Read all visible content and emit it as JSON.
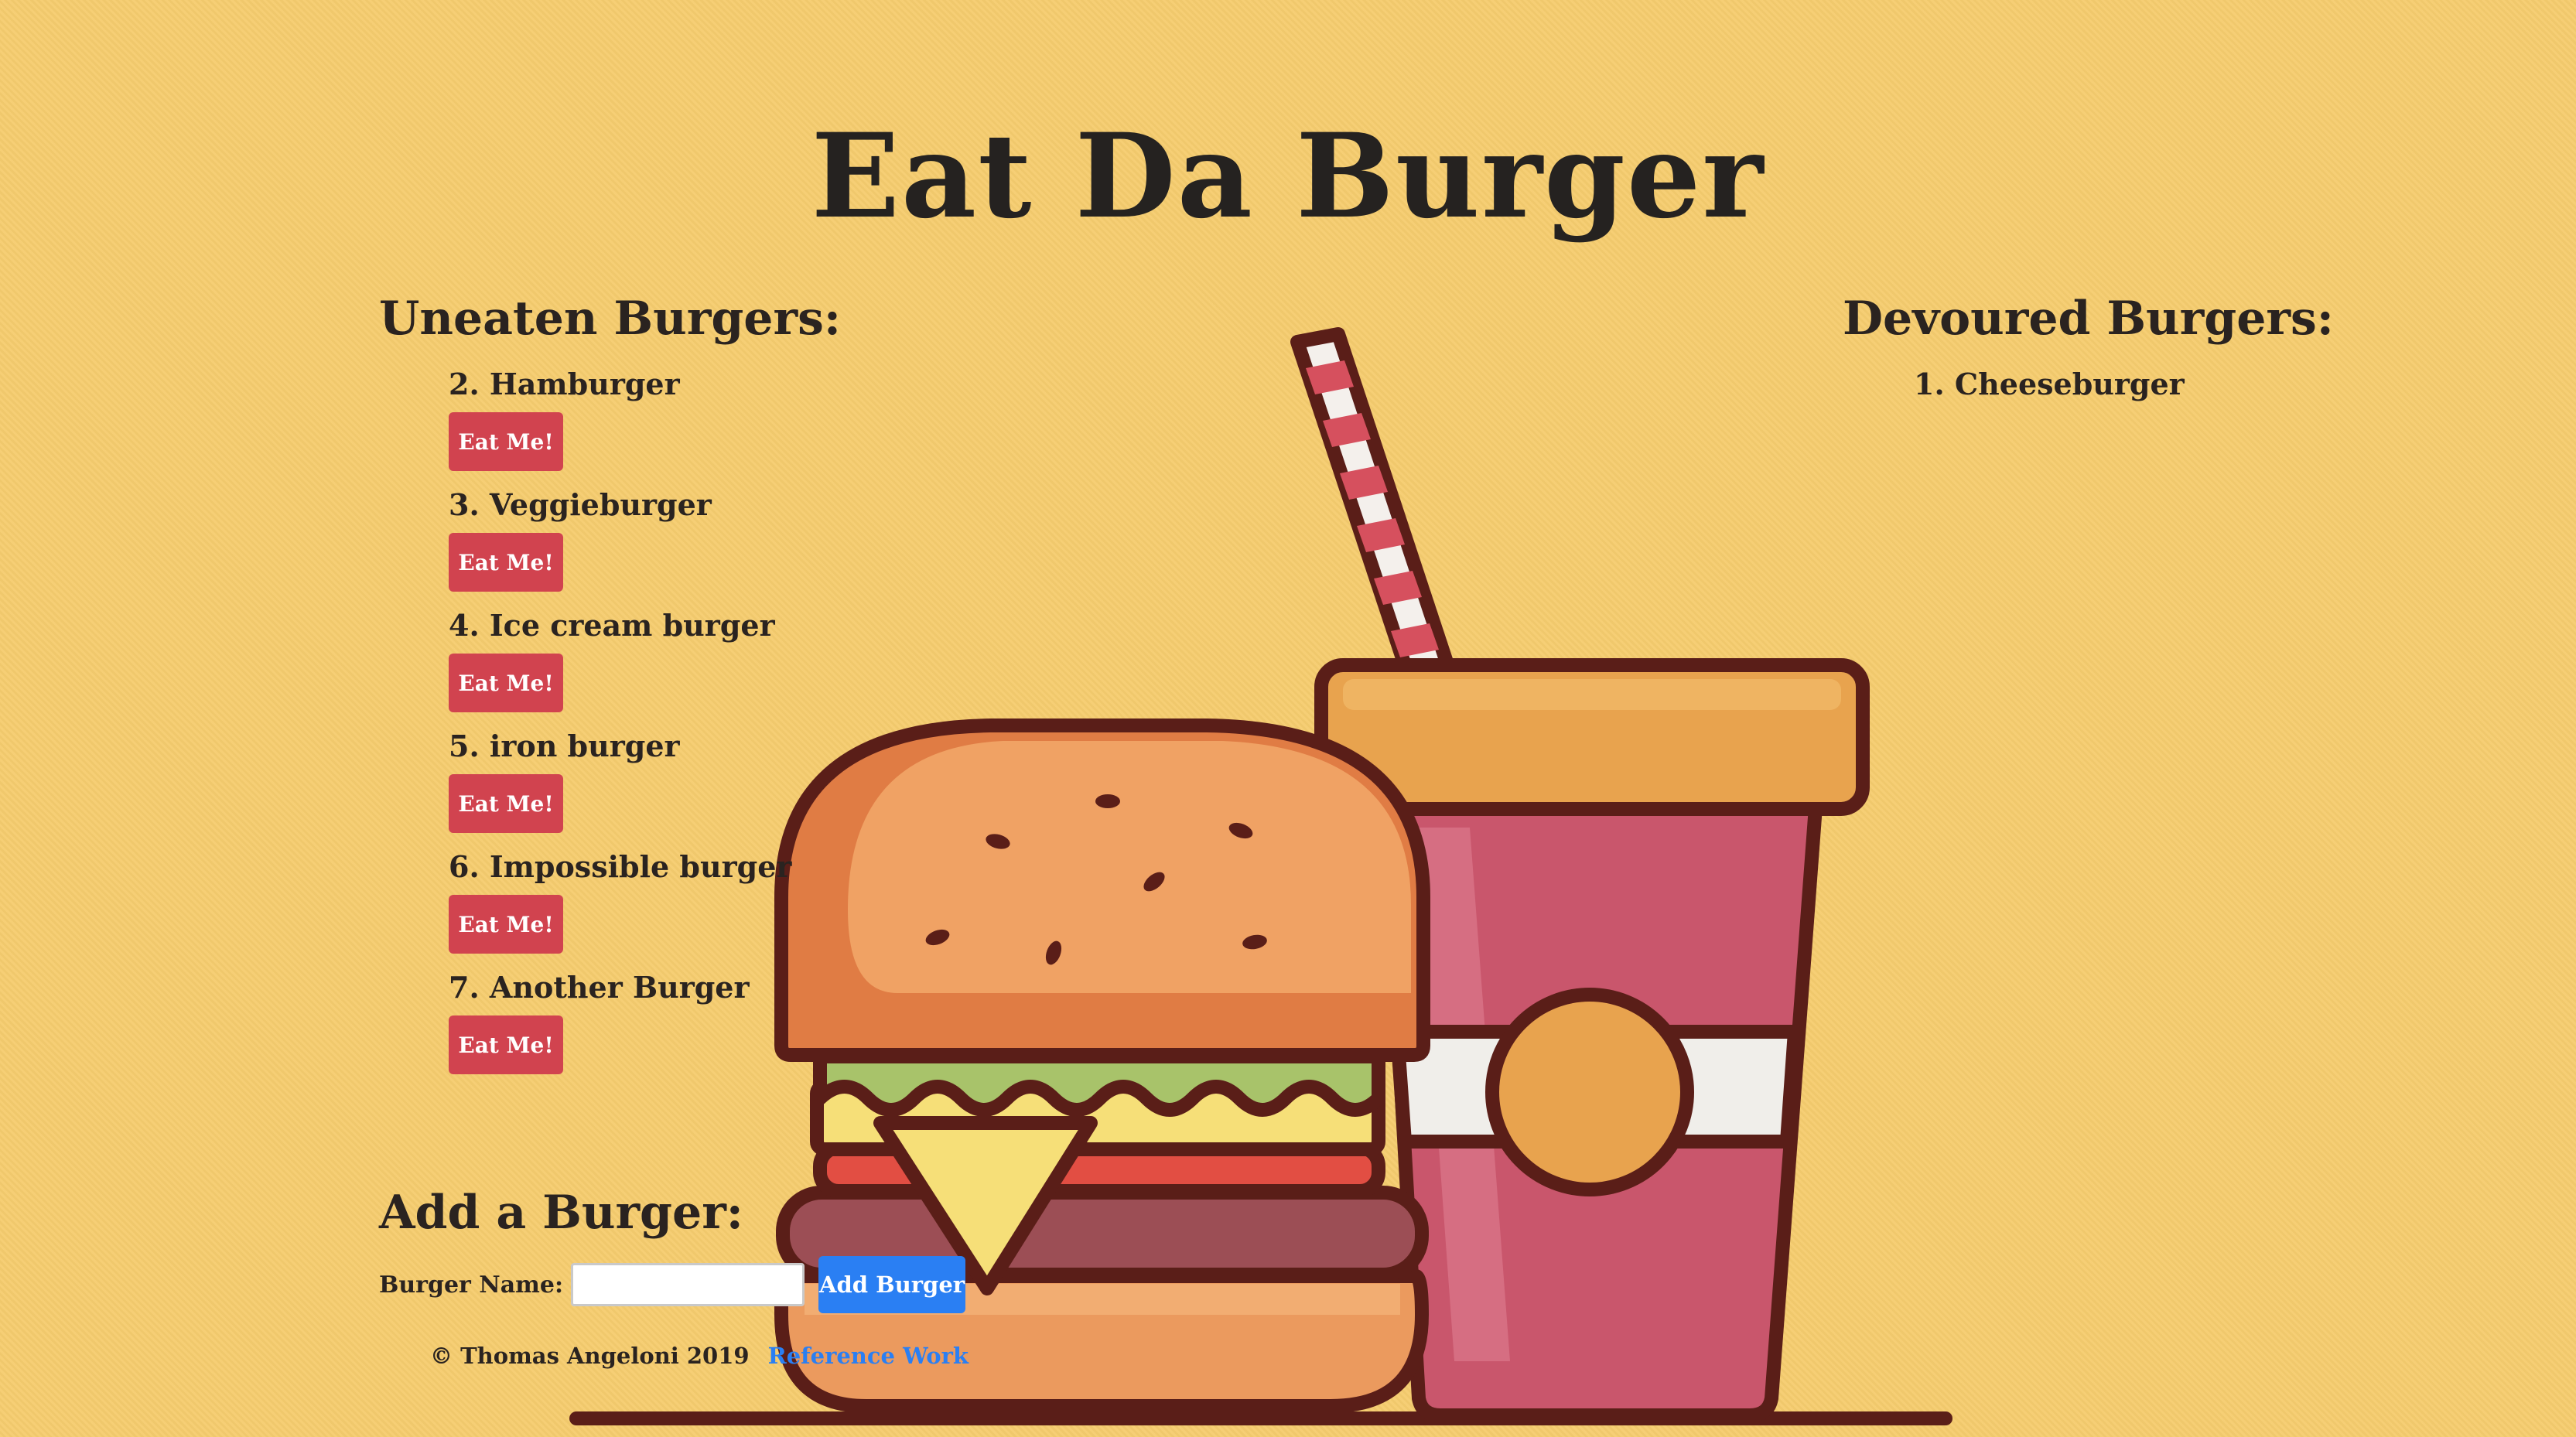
{
  "header": {
    "title": "Eat Da Burger"
  },
  "uneaten": {
    "heading": "Uneaten Burgers:",
    "items": [
      {
        "label": "2. Hamburger",
        "button": "Eat Me!"
      },
      {
        "label": "3. Veggieburger",
        "button": "Eat Me!"
      },
      {
        "label": "4. Ice cream burger",
        "button": "Eat Me!"
      },
      {
        "label": "5. iron burger",
        "button": "Eat Me!"
      },
      {
        "label": "6. Impossible burger",
        "button": "Eat Me!"
      },
      {
        "label": "7. Another Burger",
        "button": "Eat Me!"
      }
    ]
  },
  "devoured": {
    "heading": "Devoured Burgers:",
    "items": [
      {
        "label": "1. Cheeseburger"
      }
    ]
  },
  "add_form": {
    "heading": "Add a Burger:",
    "field_label": "Burger Name:",
    "field_value": "",
    "submit_label": "Add Burger"
  },
  "footer": {
    "copyright": "© Thomas Angeloni 2019",
    "link_label": "Reference Work"
  },
  "colors": {
    "background": "#f5cc6e",
    "eat_button": "#d1434f",
    "add_button": "#2a7ff3",
    "link": "#2a7ff3"
  },
  "icons": [
    "burger-illustration",
    "soda-cup-illustration"
  ]
}
